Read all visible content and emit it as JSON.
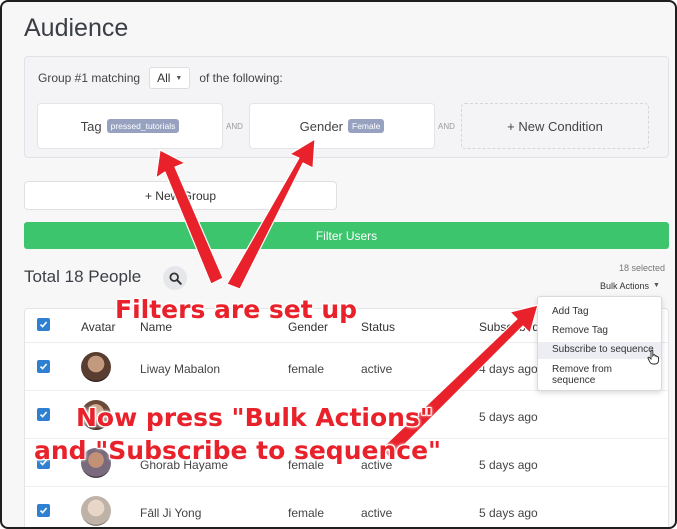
{
  "page": {
    "title": "Audience"
  },
  "group": {
    "prefix": "Group #1 matching",
    "match_value": "All",
    "suffix": "of the following:",
    "conditions": [
      {
        "field": "Tag",
        "value": "pressed_tutorials"
      },
      {
        "field": "Gender",
        "value": "Female"
      }
    ],
    "and_label": "AND",
    "new_condition_label": "+ New Condition"
  },
  "actions": {
    "new_group_label": "+ New Group",
    "filter_users_label": "Filter Users"
  },
  "results": {
    "total_label": "Total 18 People",
    "selected_label": "18 selected",
    "bulk_actions_label": "Bulk Actions"
  },
  "table": {
    "headers": [
      "Avatar",
      "Name",
      "Gender",
      "Status",
      "Subscribed"
    ],
    "rows": [
      {
        "name": "Liway Mabalon",
        "gender": "female",
        "status": "active",
        "subscribed": "4 days ago",
        "checked": true
      },
      {
        "name": "",
        "gender": "",
        "status": "",
        "subscribed": "5 days ago",
        "checked": true
      },
      {
        "name": "Ghorab Hayame",
        "gender": "female",
        "status": "active",
        "subscribed": "5 days ago",
        "checked": true
      },
      {
        "name": "Fāll Ji Yong",
        "gender": "female",
        "status": "active",
        "subscribed": "5 days ago",
        "checked": true
      }
    ]
  },
  "bulk_menu": {
    "items": [
      "Add Tag",
      "Remove Tag",
      "Subscribe to sequence",
      "Remove from sequence"
    ],
    "highlighted": "Subscribe to sequence"
  },
  "annotations": {
    "top": "Filters are set up",
    "bottom_line1": "Now press \"Bulk Actions\"",
    "bottom_line2": "and \"Subscribe to sequence\""
  },
  "colors": {
    "accent_green": "#3dc56d",
    "checkbox_blue": "#2f80d0",
    "annotation_red": "#e8212a",
    "tag_pill": "#97a2c1"
  }
}
